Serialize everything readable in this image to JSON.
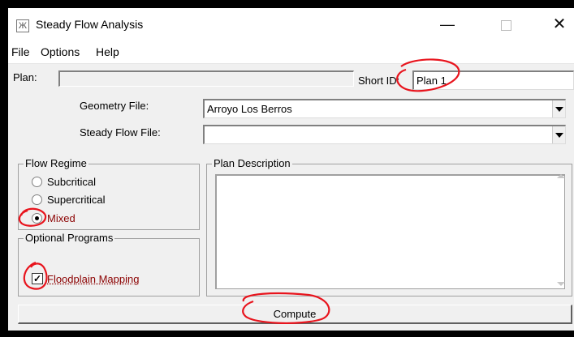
{
  "window": {
    "title": "Steady Flow Analysis",
    "app_icon": "hec-ras-icon"
  },
  "titlebar_controls": {
    "minimize": "—",
    "maximize": "",
    "close": "✕"
  },
  "menu": [
    "File",
    "Options",
    "Help"
  ],
  "plan": {
    "label": "Plan:",
    "value": "",
    "short_id_label": "Short ID:",
    "short_id_value": "Plan 1"
  },
  "geometry": {
    "label": "Geometry File:",
    "value": "Arroyo Los Berros"
  },
  "steady_flow": {
    "label": "Steady Flow File:",
    "value": ""
  },
  "flow_regime": {
    "title": "Flow Regime",
    "options": [
      "Subcritical",
      "Supercritical",
      "Mixed"
    ],
    "selected": "Mixed"
  },
  "optional_programs": {
    "title": "Optional Programs",
    "floodplain_label": "Floodplain Mapping",
    "floodplain_checked": true
  },
  "plan_description": {
    "title": "Plan Description",
    "value": ""
  },
  "compute_label": "Compute",
  "colors": {
    "annotation": "#e8141d",
    "selected_text": "#8b0000"
  }
}
